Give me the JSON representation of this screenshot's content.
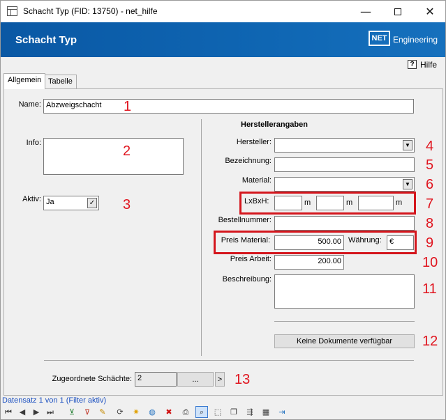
{
  "window": {
    "title": "Schacht Typ (FID: 13750)  -  net_hilfe",
    "min": "—",
    "max": "",
    "close": "✕"
  },
  "banner": {
    "heading": "Schacht Typ",
    "logo_box": "NET",
    "logo_text": "Engineering"
  },
  "help": {
    "icon": "?",
    "label": "Hilfe"
  },
  "tabs": [
    {
      "label": "Allgemein",
      "active": true
    },
    {
      "label": "Tabelle",
      "active": false
    }
  ],
  "form": {
    "name": {
      "label": "Name:",
      "value": "Abzweigschacht"
    },
    "info": {
      "label": "Info:",
      "value": ""
    },
    "aktiv": {
      "label": "Aktiv:",
      "value": "Ja",
      "check": "✓"
    },
    "hersteller_section": "Herstellerangaben",
    "hersteller": {
      "label": "Hersteller:",
      "value": ""
    },
    "bezeichnung": {
      "label": "Bezeichnung:",
      "value": ""
    },
    "material": {
      "label": "Material:",
      "value": ""
    },
    "lxbxh": {
      "label": "LxBxH:",
      "unit": "m",
      "values": [
        "",
        "",
        ""
      ]
    },
    "bestellnummer": {
      "label": "Bestellnummer:",
      "value": ""
    },
    "preis_material": {
      "label": "Preis Material:",
      "value": "500.00"
    },
    "waehrung": {
      "label": "Währung:",
      "value": "€"
    },
    "preis_arbeit": {
      "label": "Preis Arbeit:",
      "value": "200.00"
    },
    "beschreibung": {
      "label": "Beschreibung:",
      "value": ""
    },
    "dokumente_button": "Keine Dokumente verfügbar",
    "zugeordnete": {
      "label": "Zugeordnete Schächte:",
      "value": "2",
      "ellipsis_button": "...",
      "next_button": ">"
    }
  },
  "annotations": [
    "1",
    "2",
    "3",
    "4",
    "5",
    "6",
    "7",
    "8",
    "9",
    "10",
    "11",
    "12",
    "13"
  ],
  "statusbar": {
    "record_text": "Datensatz 1 von 1 (Filter aktiv)"
  },
  "colors": {
    "banner": "#0f66b3",
    "annotation_red": "#e0141e",
    "status_link": "#1a4fc0"
  }
}
